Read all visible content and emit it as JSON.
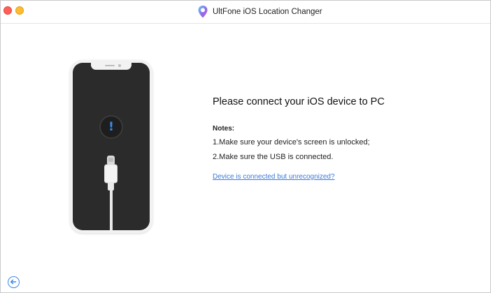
{
  "window": {
    "title": "UltFone iOS Location Changer",
    "controls": [
      "close-button",
      "minimize-button"
    ]
  },
  "main": {
    "heading": "Please connect your iOS device to PC",
    "notes_label": "Notes:",
    "notes": [
      "1.Make sure your device's screen is unlocked;",
      "2.Make sure the USB is connected."
    ],
    "help_link": "Device is connected but unrecognized?"
  },
  "icons": {
    "app_logo": "map-pin-logo",
    "alert": "exclamation-icon",
    "back": "arrow-left-icon"
  },
  "colors": {
    "accent": "#3a78d8",
    "phone_screen": "#2b2b2b",
    "alert_mark": "#3b8cf0",
    "close": "#fe5f57",
    "minimize": "#febc2e"
  }
}
